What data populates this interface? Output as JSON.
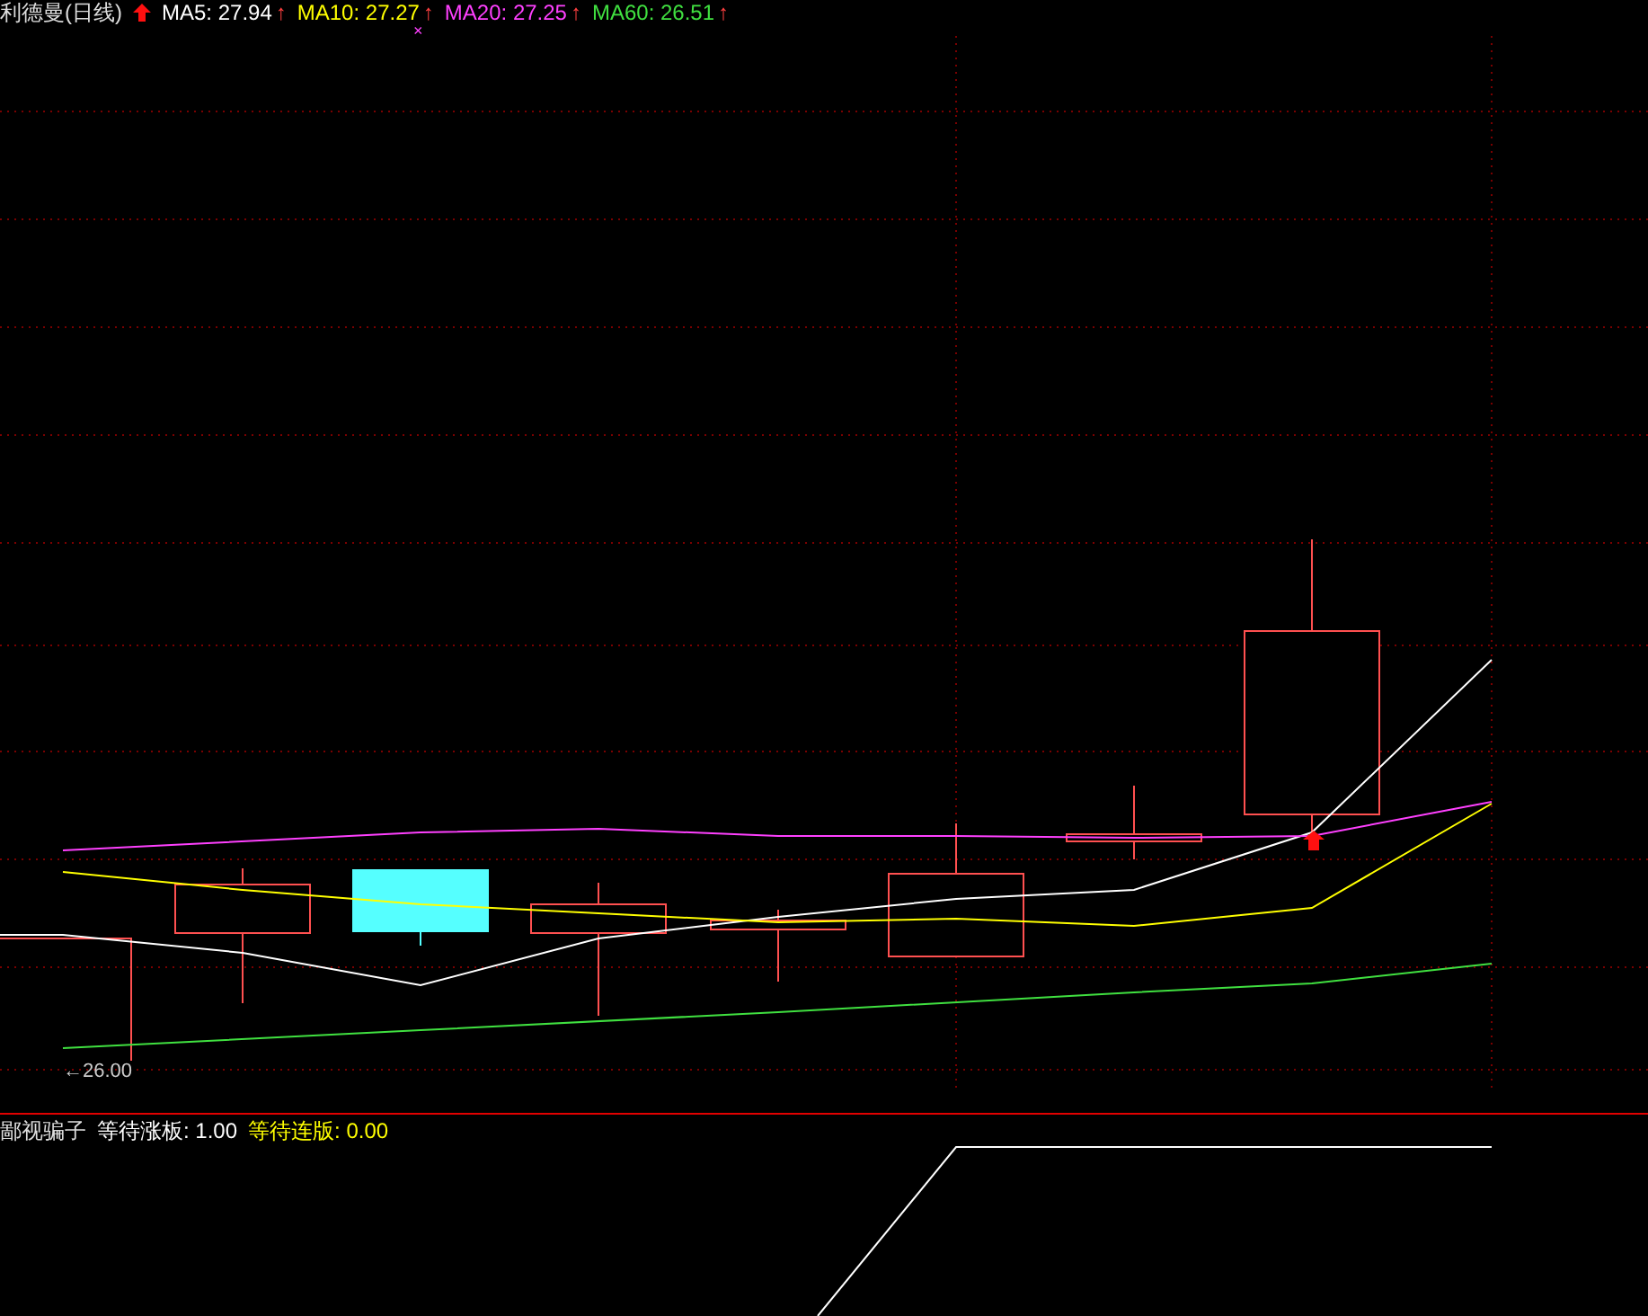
{
  "header": {
    "title": "利德曼(日线)",
    "indicators": [
      {
        "label": "MA5: 27.94",
        "arrow": "↑",
        "color": "#ffffff"
      },
      {
        "label": "MA10: 27.27",
        "arrow": "↑",
        "color": "#ffff00"
      },
      {
        "label": "MA20: 27.25",
        "arrow": "↑",
        "color": "#ff40ff"
      },
      {
        "label": "MA60: 26.51",
        "arrow": "↑",
        "color": "#40e040"
      }
    ],
    "cross_mark": "×"
  },
  "chart": {
    "low_price_label": "←26.00"
  },
  "lower_panel": {
    "title": "鄙视骗子",
    "indicators": [
      {
        "label": "等待涨板: 1.00",
        "color": "#ffffff"
      },
      {
        "label": "等待连版: 0.00",
        "color": "#ffff00"
      }
    ]
  }
}
